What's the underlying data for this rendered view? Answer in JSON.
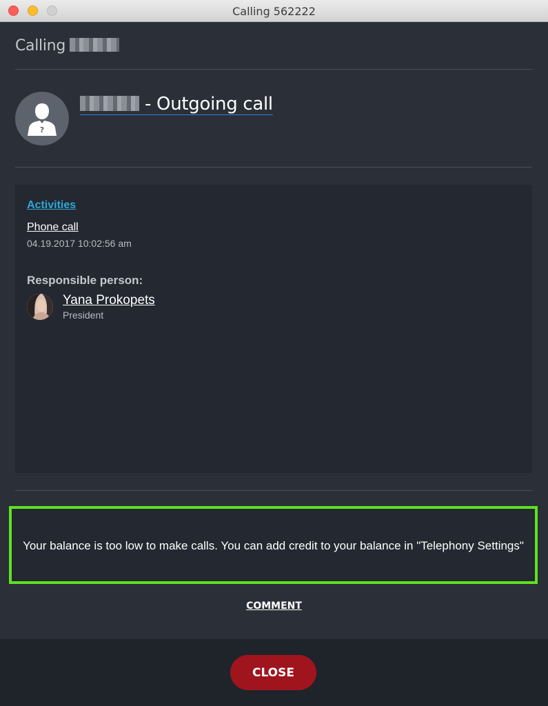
{
  "window": {
    "title": "Calling 562222"
  },
  "header": {
    "calling_label": "Calling"
  },
  "call": {
    "title": "- Outgoing call"
  },
  "activities": {
    "heading": "Activities",
    "item_label": "Phone call",
    "item_time": "04.19.2017 10:02:56 am"
  },
  "responsible": {
    "label": "Responsible person:",
    "name": "Yana Prokopets",
    "role": "President"
  },
  "alert": {
    "message": "Your balance is too low to make calls. You can add credit to your balance in \"Telephony Settings\"",
    "border_color": "#5ee31f"
  },
  "actions": {
    "comment_label": "COMMENT",
    "close_label": "CLOSE"
  },
  "icons": {
    "window_close": "close-traffic-light",
    "window_min": "minimize-traffic-light",
    "window_max": "maximize-traffic-light",
    "contact_avatar": "unknown-user-icon"
  },
  "colors": {
    "background": "#2a2f38",
    "panel": "#232831",
    "link": "#2fa8d9",
    "close_button": "#a0141e"
  }
}
